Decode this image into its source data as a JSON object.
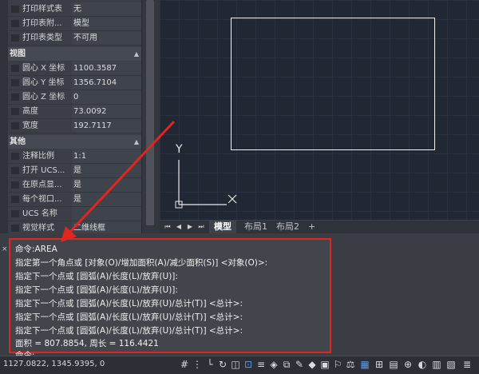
{
  "properties_panel": {
    "rows_top": [
      {
        "label": "打印样式表",
        "value": "无"
      },
      {
        "label": "打印表附...",
        "value": "模型"
      },
      {
        "label": "打印表类型",
        "value": "不可用"
      }
    ],
    "section_view": {
      "title": "视图",
      "rows": [
        {
          "label": "圆心 X 坐标",
          "value": "1100.3587"
        },
        {
          "label": "圆心 Y 坐标",
          "value": "1356.7104"
        },
        {
          "label": "圆心 Z 坐标",
          "value": "0"
        },
        {
          "label": "高度",
          "value": "73.0092"
        },
        {
          "label": "宽度",
          "value": "192.7117"
        }
      ]
    },
    "section_other": {
      "title": "其他",
      "rows": [
        {
          "label": "注释比例",
          "value": "1:1"
        },
        {
          "label": "打开 UCS...",
          "value": "是"
        },
        {
          "label": "在原点显...",
          "value": "是"
        },
        {
          "label": "每个视口...",
          "value": "是"
        },
        {
          "label": "UCS 名称",
          "value": ""
        },
        {
          "label": "视觉样式",
          "value": "二维线框"
        }
      ]
    }
  },
  "viewport": {
    "ucs_y": "Y",
    "ucs_x": "X"
  },
  "layout_tabs": {
    "tabs": [
      "模型",
      "布局1",
      "布局2"
    ],
    "add": "+",
    "active": "模型"
  },
  "command_window": {
    "lines": [
      "命令:AREA",
      "指定第一个角点或 [对象(O)/增加面积(A)/减少面积(S)] <对象(O)>:",
      "指定下一个点或 [圆弧(A)/长度(L)/放弃(U)]:",
      "指定下一个点或 [圆弧(A)/长度(L)/放弃(U)]:",
      "指定下一个点或 [圆弧(A)/长度(L)/放弃(U)/总计(T)] <总计>:",
      "指定下一个点或 [圆弧(A)/长度(L)/放弃(U)/总计(T)] <总计>:",
      "指定下一个点或 [圆弧(A)/长度(L)/放弃(U)/总计(T)] <总计>:",
      "面积 = 807.8854, 周长 = 116.4421",
      "命令:"
    ],
    "close_glyph": "×"
  },
  "status_bar": {
    "coordinates": "1127.0822, 1345.9395, 0"
  },
  "colors": {
    "highlight_box": "#e0261e",
    "arrow": "#e0261e",
    "viewport_bg": "#212733"
  }
}
